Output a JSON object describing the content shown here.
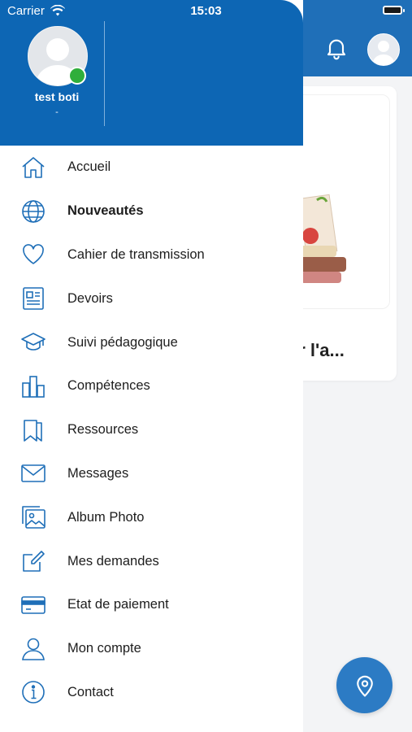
{
  "status_bar": {
    "carrier": "Carrier",
    "time": "15:03"
  },
  "profile": {
    "name": "test boti",
    "subtitle": "-"
  },
  "background": {
    "card_title": "er l'a..."
  },
  "menu": {
    "items": [
      {
        "label": "Accueil",
        "icon": "home-icon"
      },
      {
        "label": "Nouveautés",
        "icon": "globe-icon",
        "active": true
      },
      {
        "label": "Cahier de transmission",
        "icon": "heart-icon"
      },
      {
        "label": "Devoirs",
        "icon": "newspaper-icon"
      },
      {
        "label": "Suivi pédagogique",
        "icon": "graduation-cap-icon"
      },
      {
        "label": "Compétences",
        "icon": "bar-chart-icon"
      },
      {
        "label": "Ressources",
        "icon": "bookmark-icon"
      },
      {
        "label": "Messages",
        "icon": "envelope-icon"
      },
      {
        "label": "Album Photo",
        "icon": "photo-album-icon"
      },
      {
        "label": "Mes demandes",
        "icon": "edit-icon"
      },
      {
        "label": "Etat de paiement",
        "icon": "credit-card-icon"
      },
      {
        "label": "Mon compte",
        "icon": "user-icon"
      },
      {
        "label": "Contact",
        "icon": "info-icon"
      }
    ]
  },
  "colors": {
    "primary": "#0d66b4",
    "icon": "#1f6fb8",
    "online": "#2fae3b"
  }
}
